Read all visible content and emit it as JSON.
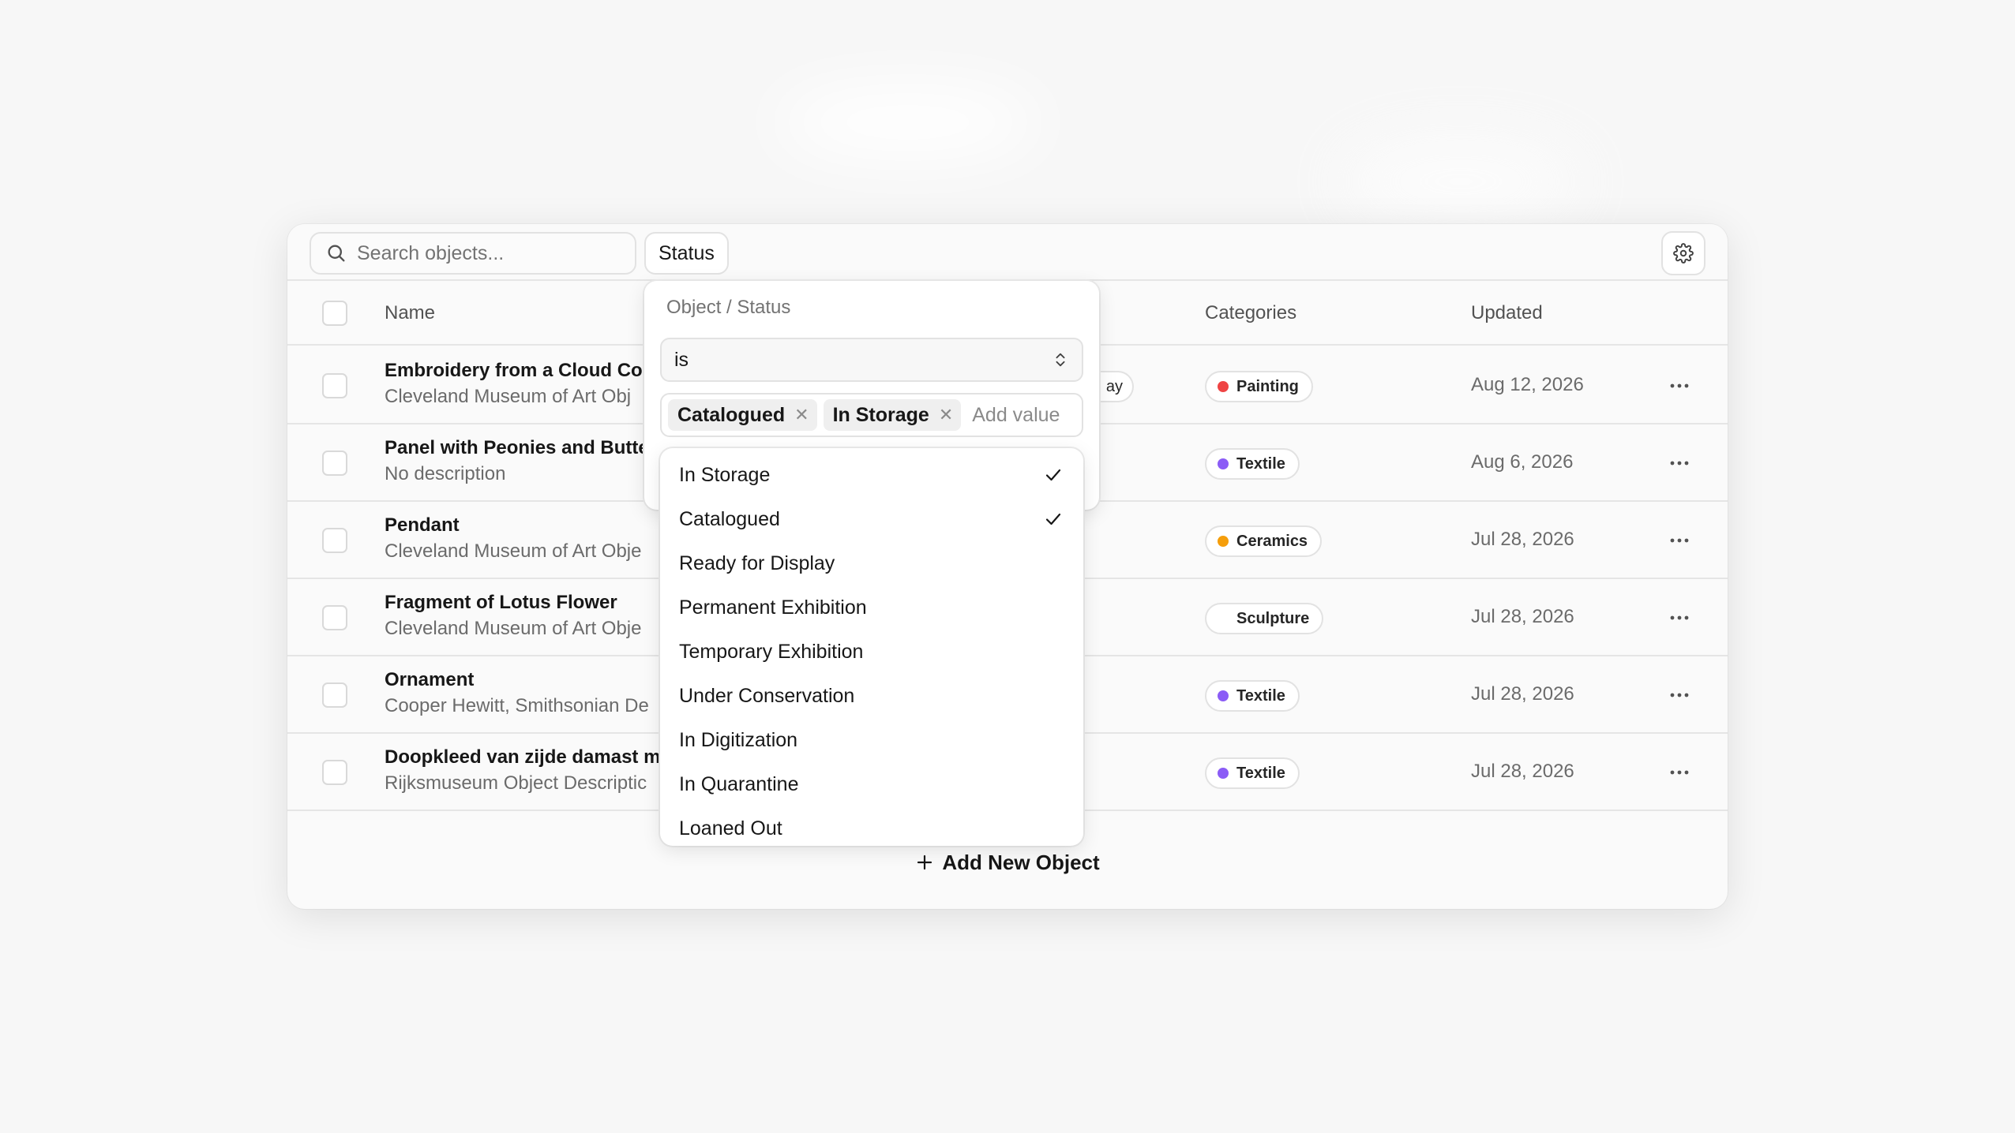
{
  "search": {
    "placeholder": "Search objects..."
  },
  "toolbar": {
    "status_filter_label": "Status"
  },
  "columns": {
    "name": "Name",
    "categories": "Categories",
    "updated": "Updated"
  },
  "rows": [
    {
      "name": "Embroidery from a Cloud Col",
      "description": "Cleveland Museum of Art Obj",
      "status_peek": "ay",
      "category": "Painting",
      "category_color": "#ef4444",
      "updated": "Aug 12, 2026"
    },
    {
      "name": "Panel with Peonies and Butte",
      "description": "No description",
      "status_peek": "",
      "category": "Textile",
      "category_color": "#8b5cf6",
      "updated": "Aug 6, 2026"
    },
    {
      "name": "Pendant",
      "description": "Cleveland Museum of Art Obje",
      "status_peek": "",
      "category": "Ceramics",
      "category_color": "#f59e0b",
      "updated": "Jul 28, 2026"
    },
    {
      "name": "Fragment of Lotus Flower",
      "description": "Cleveland Museum of Art Obje",
      "status_peek": "",
      "category": "Sculpture",
      "category_color": "",
      "updated": "Jul 28, 2026"
    },
    {
      "name": "Ornament",
      "description": "Cooper Hewitt, Smithsonian De",
      "status_peek": "",
      "category": "Textile",
      "category_color": "#8b5cf6",
      "updated": "Jul 28, 2026"
    },
    {
      "name": "Doopkleed van zijde damast m",
      "description": "Rijksmuseum Object Descriptic",
      "status_peek": "",
      "category": "Textile",
      "category_color": "#8b5cf6",
      "updated": "Jul 28, 2026"
    }
  ],
  "add_new_label": "Add New Object",
  "filter_popover": {
    "breadcrumb": "Object / Status",
    "operator": "is",
    "selected_values": [
      "Catalogued",
      "In Storage"
    ],
    "add_value_placeholder": "Add value"
  },
  "status_options": [
    {
      "label": "In Storage",
      "checked": true
    },
    {
      "label": "Catalogued",
      "checked": true
    },
    {
      "label": "Ready for Display",
      "checked": false
    },
    {
      "label": "Permanent Exhibition",
      "checked": false
    },
    {
      "label": "Temporary Exhibition",
      "checked": false
    },
    {
      "label": "Under Conservation",
      "checked": false
    },
    {
      "label": "In Digitization",
      "checked": false
    },
    {
      "label": "In Quarantine",
      "checked": false
    },
    {
      "label": "Loaned Out",
      "checked": false
    }
  ],
  "icons": {
    "search": "search-icon",
    "settings": "gear-icon",
    "more": "more-horizontal-icon",
    "add": "plus-icon",
    "chevrons": "chevron-up-down-icon",
    "remove": "close-icon",
    "check": "check-icon"
  }
}
